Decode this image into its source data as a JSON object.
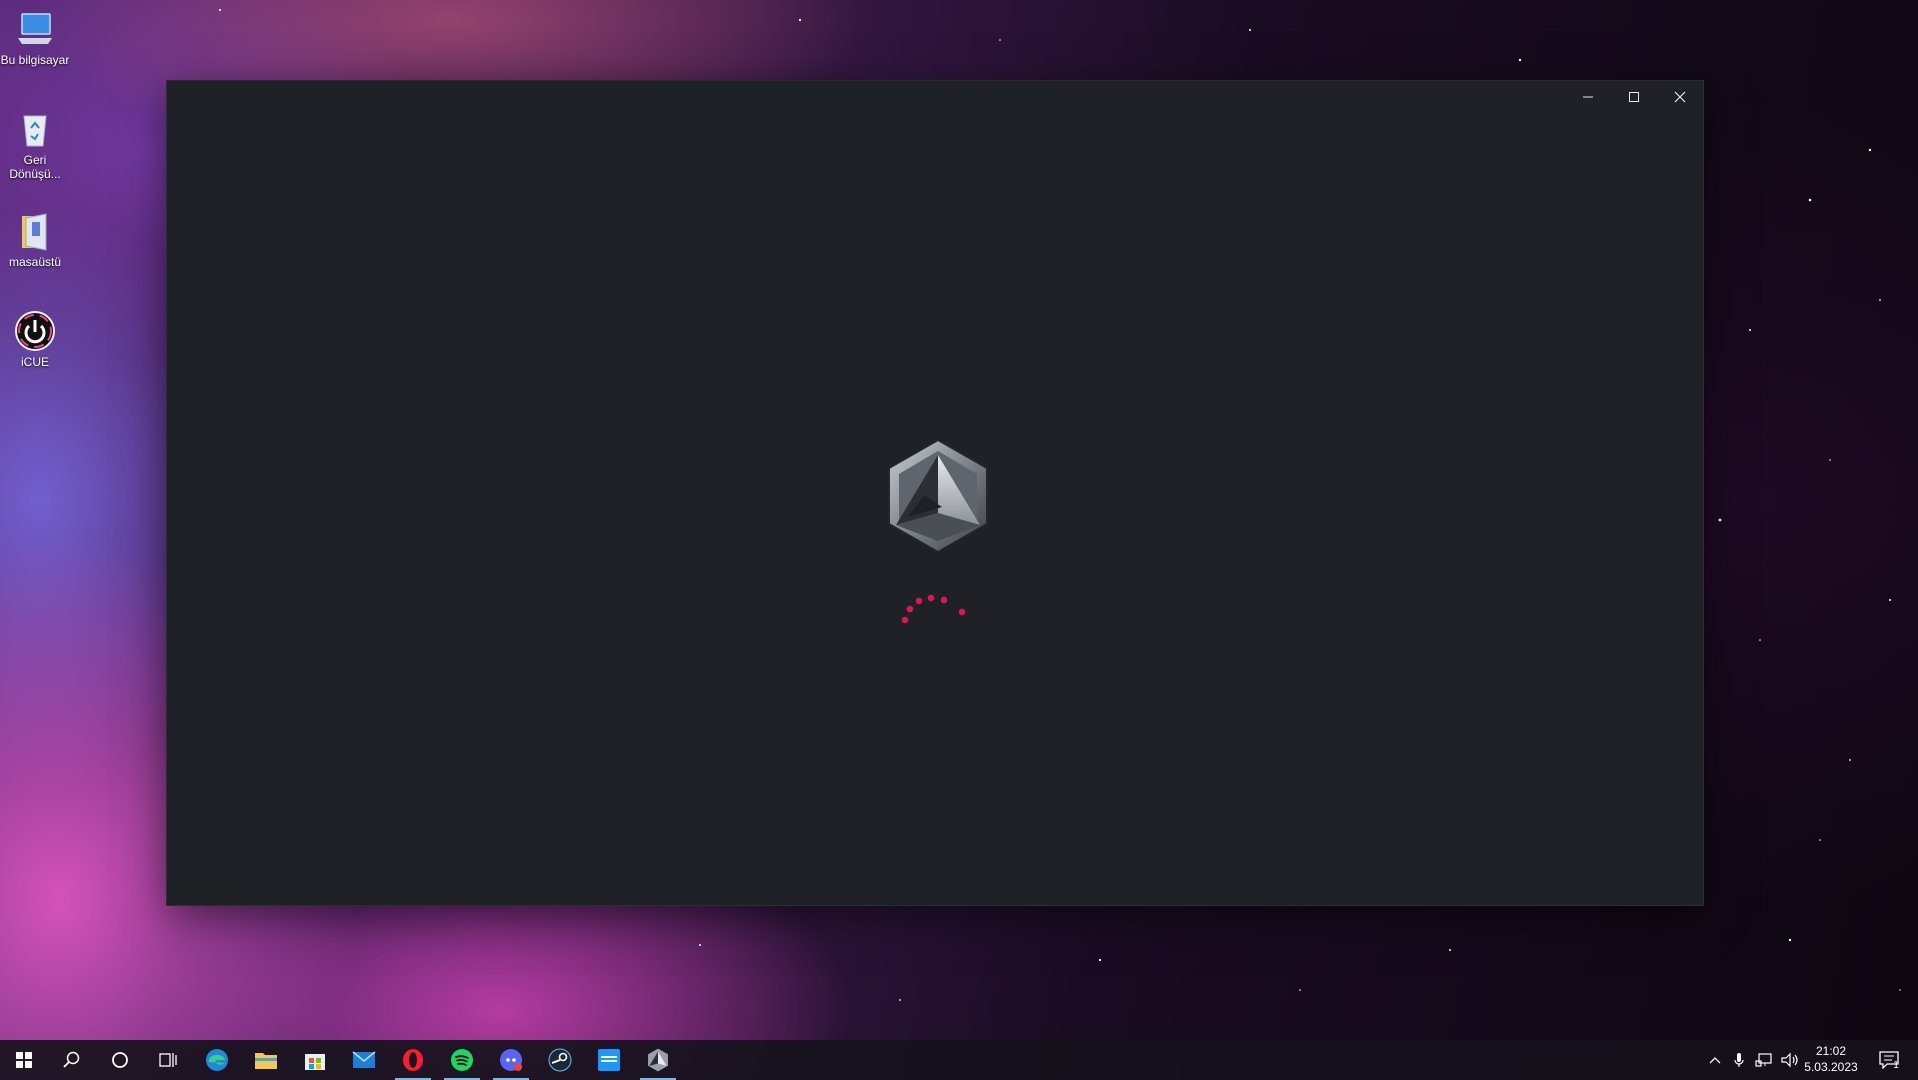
{
  "desktop": {
    "icons": [
      {
        "label": "Bu bilgisayar",
        "icon": "this-pc-icon"
      },
      {
        "label": "Geri Dönüşü...",
        "icon": "recycle-bin-icon"
      },
      {
        "label": "masaüstü",
        "icon": "folder-icon"
      },
      {
        "label": "iCUE",
        "icon": "icue-icon"
      }
    ]
  },
  "window": {
    "controls": {
      "minimize": "minimize-icon",
      "maximize": "maximize-icon",
      "close": "close-icon"
    },
    "background": "#1e2125",
    "spinner_color": "#e0164f",
    "state": "loading"
  },
  "taskbar": {
    "pinned": [
      {
        "name": "start",
        "icon": "windows-start-icon"
      },
      {
        "name": "search",
        "icon": "search-icon"
      },
      {
        "name": "cortana",
        "icon": "cortana-icon"
      },
      {
        "name": "task-view",
        "icon": "task-view-icon"
      },
      {
        "name": "edge",
        "icon": "edge-icon"
      },
      {
        "name": "file-explorer",
        "icon": "folder-icon"
      },
      {
        "name": "microsoft-store",
        "icon": "store-icon"
      },
      {
        "name": "mail",
        "icon": "mail-icon"
      },
      {
        "name": "opera",
        "icon": "opera-icon",
        "running": true
      },
      {
        "name": "spotify",
        "icon": "spotify-icon",
        "running": true
      },
      {
        "name": "discord",
        "icon": "discord-icon",
        "running": true
      },
      {
        "name": "steam",
        "icon": "steam-icon"
      },
      {
        "name": "prime-video",
        "icon": "prime-video-icon"
      },
      {
        "name": "app-loader",
        "icon": "hexagon-logo-icon",
        "running": true
      }
    ],
    "tray": {
      "time": "21:02",
      "date": "5.03.2023",
      "notification_count": "1"
    }
  }
}
